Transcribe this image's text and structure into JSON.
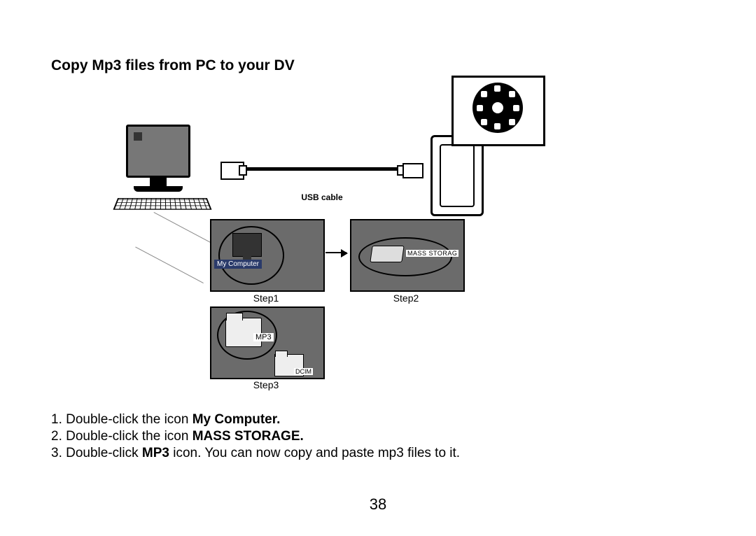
{
  "title": "Copy Mp3 files from PC to your DV",
  "diagram": {
    "cable_label": "USB cable",
    "panel1_icon_label": "My Computer",
    "panel2_icon_label": "MASS STORAG",
    "panel3_folder_big": "MP3",
    "panel3_folder_small": "DCIM",
    "step1": "Step1",
    "step2": "Step2",
    "step3": "Step3"
  },
  "instructions": {
    "l1a": "1. Double-click the icon ",
    "l1b": "My Computer.",
    "l2a": "2. Double-click the icon ",
    "l2b": "MASS STORAGE.",
    "l3a": "3. Double-click ",
    "l3b": "MP3",
    "l3c": " icon. You can now copy and paste mp3 files to it."
  },
  "page_number": "38"
}
